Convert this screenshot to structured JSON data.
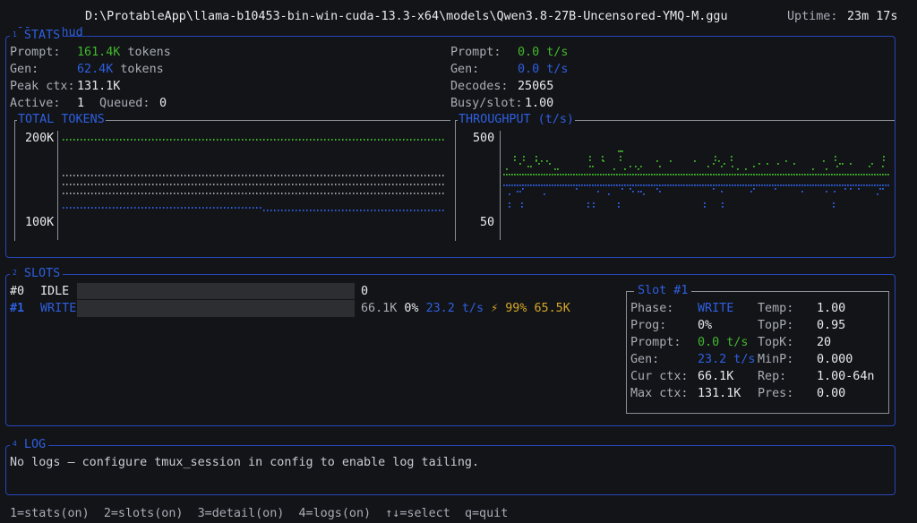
{
  "header": {
    "app_name": "llama-hud",
    "model_path": "D:\\ProtableApp\\llama-b10453-bin-win-cuda-13.3-x64\\models\\Qwen3.8-27B-Uncensored-YMQ-M.ggu",
    "uptime_label": "Uptime:",
    "uptime_value": "23m 17s"
  },
  "stats": {
    "number": "1",
    "title": "STATS",
    "prompt_label": "Prompt:",
    "prompt_tokens": "161.4K",
    "tokens_word": "tokens",
    "gen_label": "Gen:",
    "gen_tokens": "62.4K",
    "peak_ctx_label": "Peak ctx:",
    "peak_ctx_value": "131.1K",
    "active_label": "Active:",
    "active_value": "1",
    "queued_label": "Queued:",
    "queued_value": "0",
    "prompt_rate_label": "Prompt:",
    "prompt_rate_value": "0.0 t/s",
    "gen_rate_label": "Gen:",
    "gen_rate_value": "0.0 t/s",
    "decodes_label": "Decodes:",
    "decodes_value": "25065",
    "busy_label": "Busy/slot:",
    "busy_value": "1.00",
    "total_tokens_title": "TOTAL TOKENS",
    "total_tokens_ytop": "200K",
    "total_tokens_ybottom": "100K",
    "throughput_title": "THROUGHPUT (t/s)",
    "throughput_ytop": "500",
    "throughput_ybottom": "50"
  },
  "slots": {
    "number": "2",
    "title": "SLOTS",
    "rows": [
      {
        "id": "#0",
        "state": "IDLE",
        "tokens": "0",
        "progress": 0.0
      },
      {
        "id": "#1",
        "state": "WRITE",
        "tokens": "66.1K",
        "percent": "0%",
        "rate": "23.2 t/s",
        "bolt": "⚡",
        "util": "99%",
        "ctx": "65.5K",
        "progress": 0.0
      }
    ]
  },
  "slot_detail": {
    "title": "Slot #1",
    "phase_label": "Phase:",
    "phase_value": "WRITE",
    "prog_label": "Prog:",
    "prog_value": "0%",
    "prompt_label": "Prompt:",
    "prompt_value": "0.0 t/s",
    "gen_label": "Gen:",
    "gen_value": "23.2 t/s",
    "cur_ctx_label": "Cur ctx:",
    "cur_ctx_value": "66.1K",
    "max_ctx_label": "Max ctx:",
    "max_ctx_value": "131.1K",
    "temp_label": "Temp:",
    "temp_value": "1.00",
    "topp_label": "TopP:",
    "topp_value": "0.95",
    "topk_label": "TopK:",
    "topk_value": "20",
    "minp_label": "MinP:",
    "minp_value": "0.000",
    "rep_label": "Rep:",
    "rep_value": "1.00-64n",
    "pres_label": "Pres:",
    "pres_value": "0.00"
  },
  "log": {
    "number": "4",
    "title": "LOG",
    "message": "No logs — configure tmux_session in config to enable log tailing."
  },
  "footer": {
    "keys": [
      "1=stats(on)",
      "2=slots(on)",
      "3=detail(on)",
      "4=logs(on)",
      "↑↓=select",
      "q=quit"
    ]
  },
  "colors": {
    "accent": "#2f5fe0",
    "green": "#43b82c",
    "yellow": "#d6a726",
    "background": "#121418"
  }
}
